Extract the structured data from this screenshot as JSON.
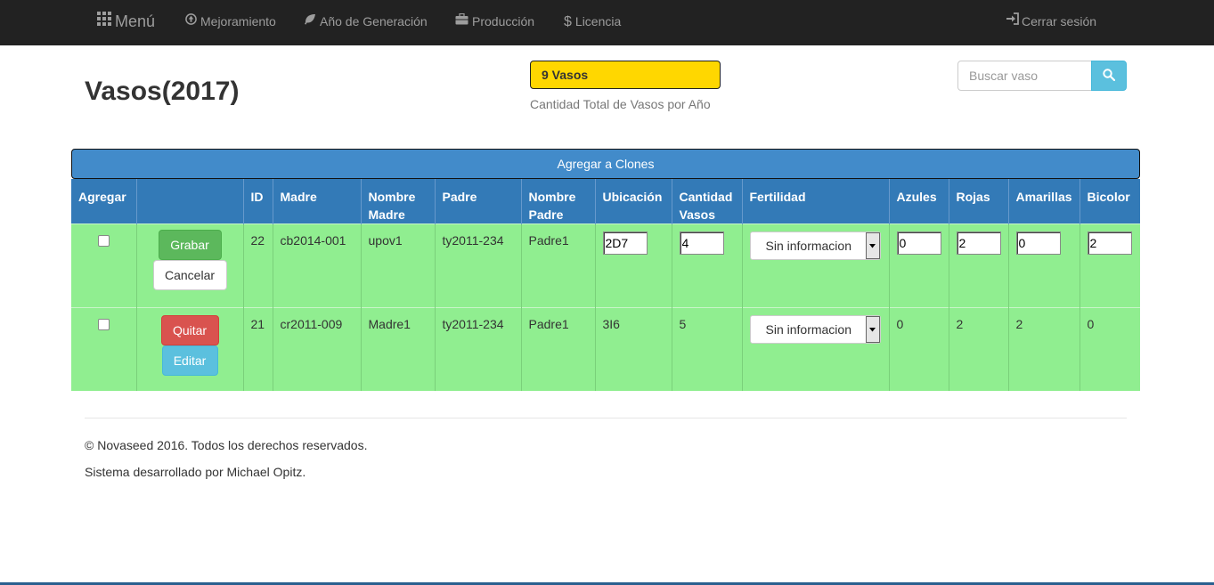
{
  "navbar": {
    "brand": "Menú",
    "items": [
      "Mejoramiento",
      "Año de Generación",
      "Producción",
      "Licencia"
    ],
    "logout": "Cerrar sesión",
    "icons": [
      "grid-icon",
      "arrow-circle-up-icon",
      "leaf-icon",
      "briefcase-icon",
      "dollar-icon",
      "sign-in-icon"
    ]
  },
  "header": {
    "title": "Vasos(2017)",
    "count_badge": "9 Vasos",
    "count_caption": "Cantidad Total de Vasos por Año",
    "search_placeholder": "Buscar vaso",
    "badge_color": "#ffd700"
  },
  "clone_bar": {
    "label": "Agregar a Clones"
  },
  "table": {
    "headers": [
      "Agregar",
      "",
      "ID",
      "Madre",
      "Nombre Madre",
      "Padre",
      "Nombre Padre",
      "Ubicación",
      "Cantidad Vasos",
      "Fertilidad",
      "Azules",
      "Rojas",
      "Amarillas",
      "Bicolor"
    ],
    "header_color": "#337ab7",
    "row_color": "#90ee90",
    "rows": [
      {
        "mode": "edit",
        "buttons": [
          "Grabar",
          "Cancelar"
        ],
        "id": "22",
        "madre": "cb2014-001",
        "nombre_madre": "upov1",
        "padre": "ty2011-234",
        "nombre_padre": "Padre1",
        "ubicacion": "2D7",
        "cantidad": "4",
        "fertilidad": "Sin informacion",
        "azules": "0",
        "rojas": "2",
        "amarillas": "0",
        "bicolor": "2"
      },
      {
        "mode": "view",
        "buttons": [
          "Quitar",
          "Editar"
        ],
        "id": "21",
        "madre": "cr2011-009",
        "nombre_madre": "Madre1",
        "padre": "ty2011-234",
        "nombre_padre": "Padre1",
        "ubicacion": "3I6",
        "cantidad": "5",
        "fertilidad": "Sin informacion",
        "azules": "0",
        "rojas": "2",
        "amarillas": "2",
        "bicolor": "0"
      }
    ]
  },
  "footer": {
    "copyright": "© Novaseed 2016. Todos los derechos reservados.",
    "developer": "Sistema desarrollado por Michael Opitz."
  }
}
